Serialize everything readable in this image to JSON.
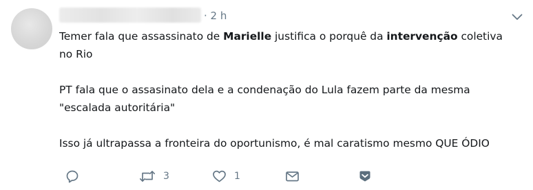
{
  "tweet": {
    "time": "· 2 h",
    "lines": {
      "l1_a": "Temer fala que assassinato de ",
      "l1_b": "Marielle",
      "l1_c": " justifica o porquê da ",
      "l1_d": "intervenção",
      "l1_e": " coletiva",
      "l2": "no Rio",
      "l3": "PT fala que o assasinato dela e a condenação do Lula fazem parte da mesma",
      "l4": "\"escalada autoritária\"",
      "l5": "Isso já ultrapassa a fronteira do oportunismo, é mal caratismo mesmo QUE ÓDIO"
    },
    "actions": {
      "reply_icon": "reply-icon",
      "retweet_icon": "retweet-icon",
      "retweet_count": "3",
      "like_icon": "heart-icon",
      "like_count": "1",
      "dm_icon": "envelope-icon",
      "save_icon": "bookmark-icon"
    },
    "colors": {
      "text": "#14171a",
      "muted": "#657786",
      "save_icon": "#5b6e7d"
    }
  }
}
